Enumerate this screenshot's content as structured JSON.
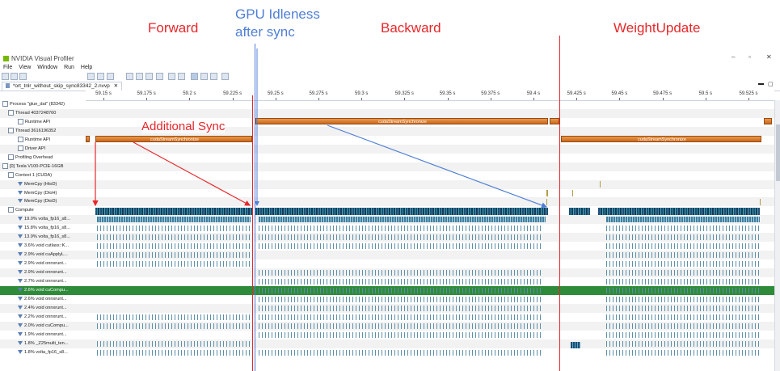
{
  "annotations": {
    "forward": "Forward",
    "gpu_idleness_line1": "GPU Idleness",
    "gpu_idleness_line2": "after sync",
    "backward": "Backward",
    "weight_update": "WeightUpdate",
    "additional_sync": "Additional Sync"
  },
  "colors": {
    "annotation_red": "#e8262a",
    "annotation_blue": "#4f7fd6",
    "selected_row": "#2e8b3a",
    "api_bar": "#d9792a"
  },
  "window": {
    "title": "NVIDIA Visual Profiler"
  },
  "menu": [
    "File",
    "View",
    "Window",
    "Run",
    "Help"
  ],
  "editor_tab": {
    "label": "*ort_tnlr_without_skip_sync83342_2.nvvp"
  },
  "ruler_ticks": [
    "59.15 s",
    "59.175 s",
    "59.2 s",
    "59.225 s",
    "59.25 s",
    "59.275 s",
    "59.3 s",
    "59.325 s",
    "59.35 s",
    "59.375 s",
    "59.4 s",
    "59.425 s",
    "59.45 s",
    "59.475 s",
    "59.5 s",
    "59.525 s"
  ],
  "timeline_rows": [
    "Process \"glue_dat\" (83342)",
    "Thread 4037248760",
    "Runtime API",
    "Thread 3616196352",
    "Runtime API",
    "Driver API",
    "Profiling Overhead",
    "[0] Tesla V100-PCIE-16GB",
    "Context 1 (CUDA)",
    "MemCpy (HtoD)",
    "MemCpy (DtoH)",
    "MemCpy (DtoD)",
    "Compute",
    "19.0% volta_fp16_s8...",
    "15.8% volta_fp16_s8...",
    "13.9% volta_fp16_s8...",
    "3.6% void cutlass::K...",
    "2.9% void cuApplyL...",
    "2.9% void onnxrunt...",
    "2.9% void onnxrunt...",
    "2.7% void onnxrunt...",
    "2.6% void cuCompu...",
    "2.6% void onnxrunt...",
    "2.4% void onnxrunt...",
    "2.2% void onnxrunt...",
    "2.0% void cuCompu...",
    "1.9% void onnxrunt...",
    "1.8% _Z25multi_ten...",
    "1.8% volta_fp16_s8..."
  ],
  "api_bars": {
    "sync_label": "cudaStreamSynchronize"
  }
}
